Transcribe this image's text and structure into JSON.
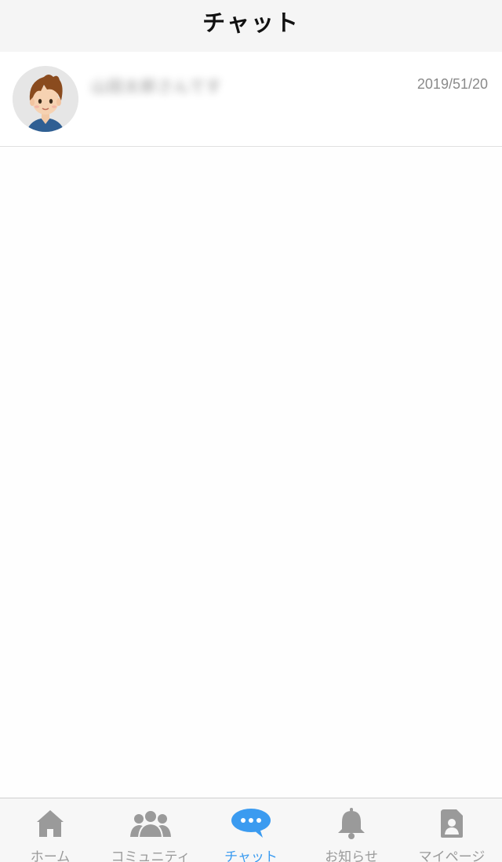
{
  "header": {
    "title": "チャット"
  },
  "chats": [
    {
      "name": "山田太郎さんです",
      "date": "2019/51/20"
    }
  ],
  "tabbar": {
    "active": "chat",
    "tabs": [
      {
        "id": "home",
        "label": "ホーム",
        "icon": "home-icon"
      },
      {
        "id": "community",
        "label": "コミュニティ",
        "icon": "community-icon"
      },
      {
        "id": "chat",
        "label": "チャット",
        "icon": "chat-bubble-icon"
      },
      {
        "id": "notice",
        "label": "お知らせ",
        "icon": "bell-icon"
      },
      {
        "id": "mypage",
        "label": "マイページ",
        "icon": "profile-icon"
      }
    ]
  },
  "colors": {
    "active": "#3b9bf0",
    "inactive": "#9a9a9a",
    "header_bg": "#f5f5f5"
  }
}
